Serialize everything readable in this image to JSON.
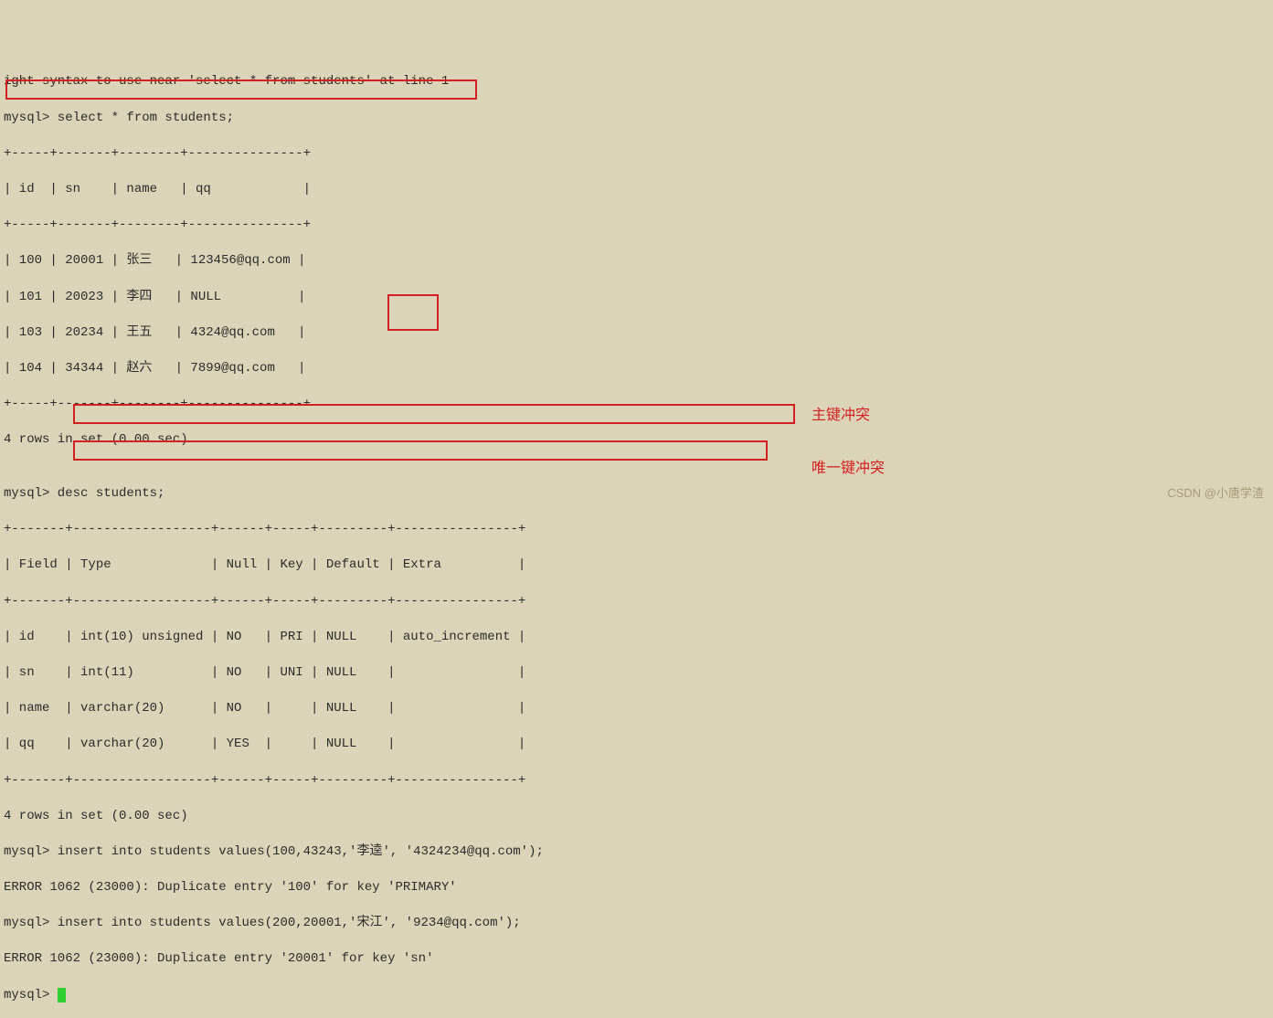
{
  "lines": {
    "l0": "ight syntax to use near 'select * from students' at line 1",
    "l1": "mysql> select * from students;",
    "l2": "+-----+-------+--------+---------------+",
    "l3": "| id  | sn    | name   | qq            |",
    "l4": "+-----+-------+--------+---------------+",
    "l5": "| 100 | 20001 | 张三   | 123456@qq.com |",
    "l6": "| 101 | 20023 | 李四   | NULL          |",
    "l7": "| 103 | 20234 | 王五   | 4324@qq.com   |",
    "l8": "| 104 | 34344 | 赵六   | 7899@qq.com   |",
    "l9": "+-----+-------+--------+---------------+",
    "l10": "4 rows in set (0.00 sec)",
    "l11": "",
    "l12": "mysql> desc students;",
    "l13": "+-------+------------------+------+-----+---------+----------------+",
    "l14": "| Field | Type             | Null | Key | Default | Extra          |",
    "l15": "+-------+------------------+------+-----+---------+----------------+",
    "l16": "| id    | int(10) unsigned | NO   | PRI | NULL    | auto_increment |",
    "l17": "| sn    | int(11)          | NO   | UNI | NULL    |                |",
    "l18": "| name  | varchar(20)      | NO   |     | NULL    |                |",
    "l19": "| qq    | varchar(20)      | YES  |     | NULL    |                |",
    "l20": "+-------+------------------+------+-----+---------+----------------+",
    "l21": "4 rows in set (0.00 sec)",
    "l22": "mysql> insert into students values(100,43243,'李逵', '4324234@qq.com');",
    "l23": "ERROR 1062 (23000): Duplicate entry '100' for key 'PRIMARY'",
    "l24": "mysql> insert into students values(200,20001,'宋江', '9234@qq.com');",
    "l25": "ERROR 1062 (23000): Duplicate entry '20001' for key 'sn'",
    "l26": "mysql> "
  },
  "annotations": {
    "primary_key_conflict": "主键冲突",
    "unique_key_conflict": "唯一键冲突"
  },
  "watermark": "CSDN @小唐学渣"
}
